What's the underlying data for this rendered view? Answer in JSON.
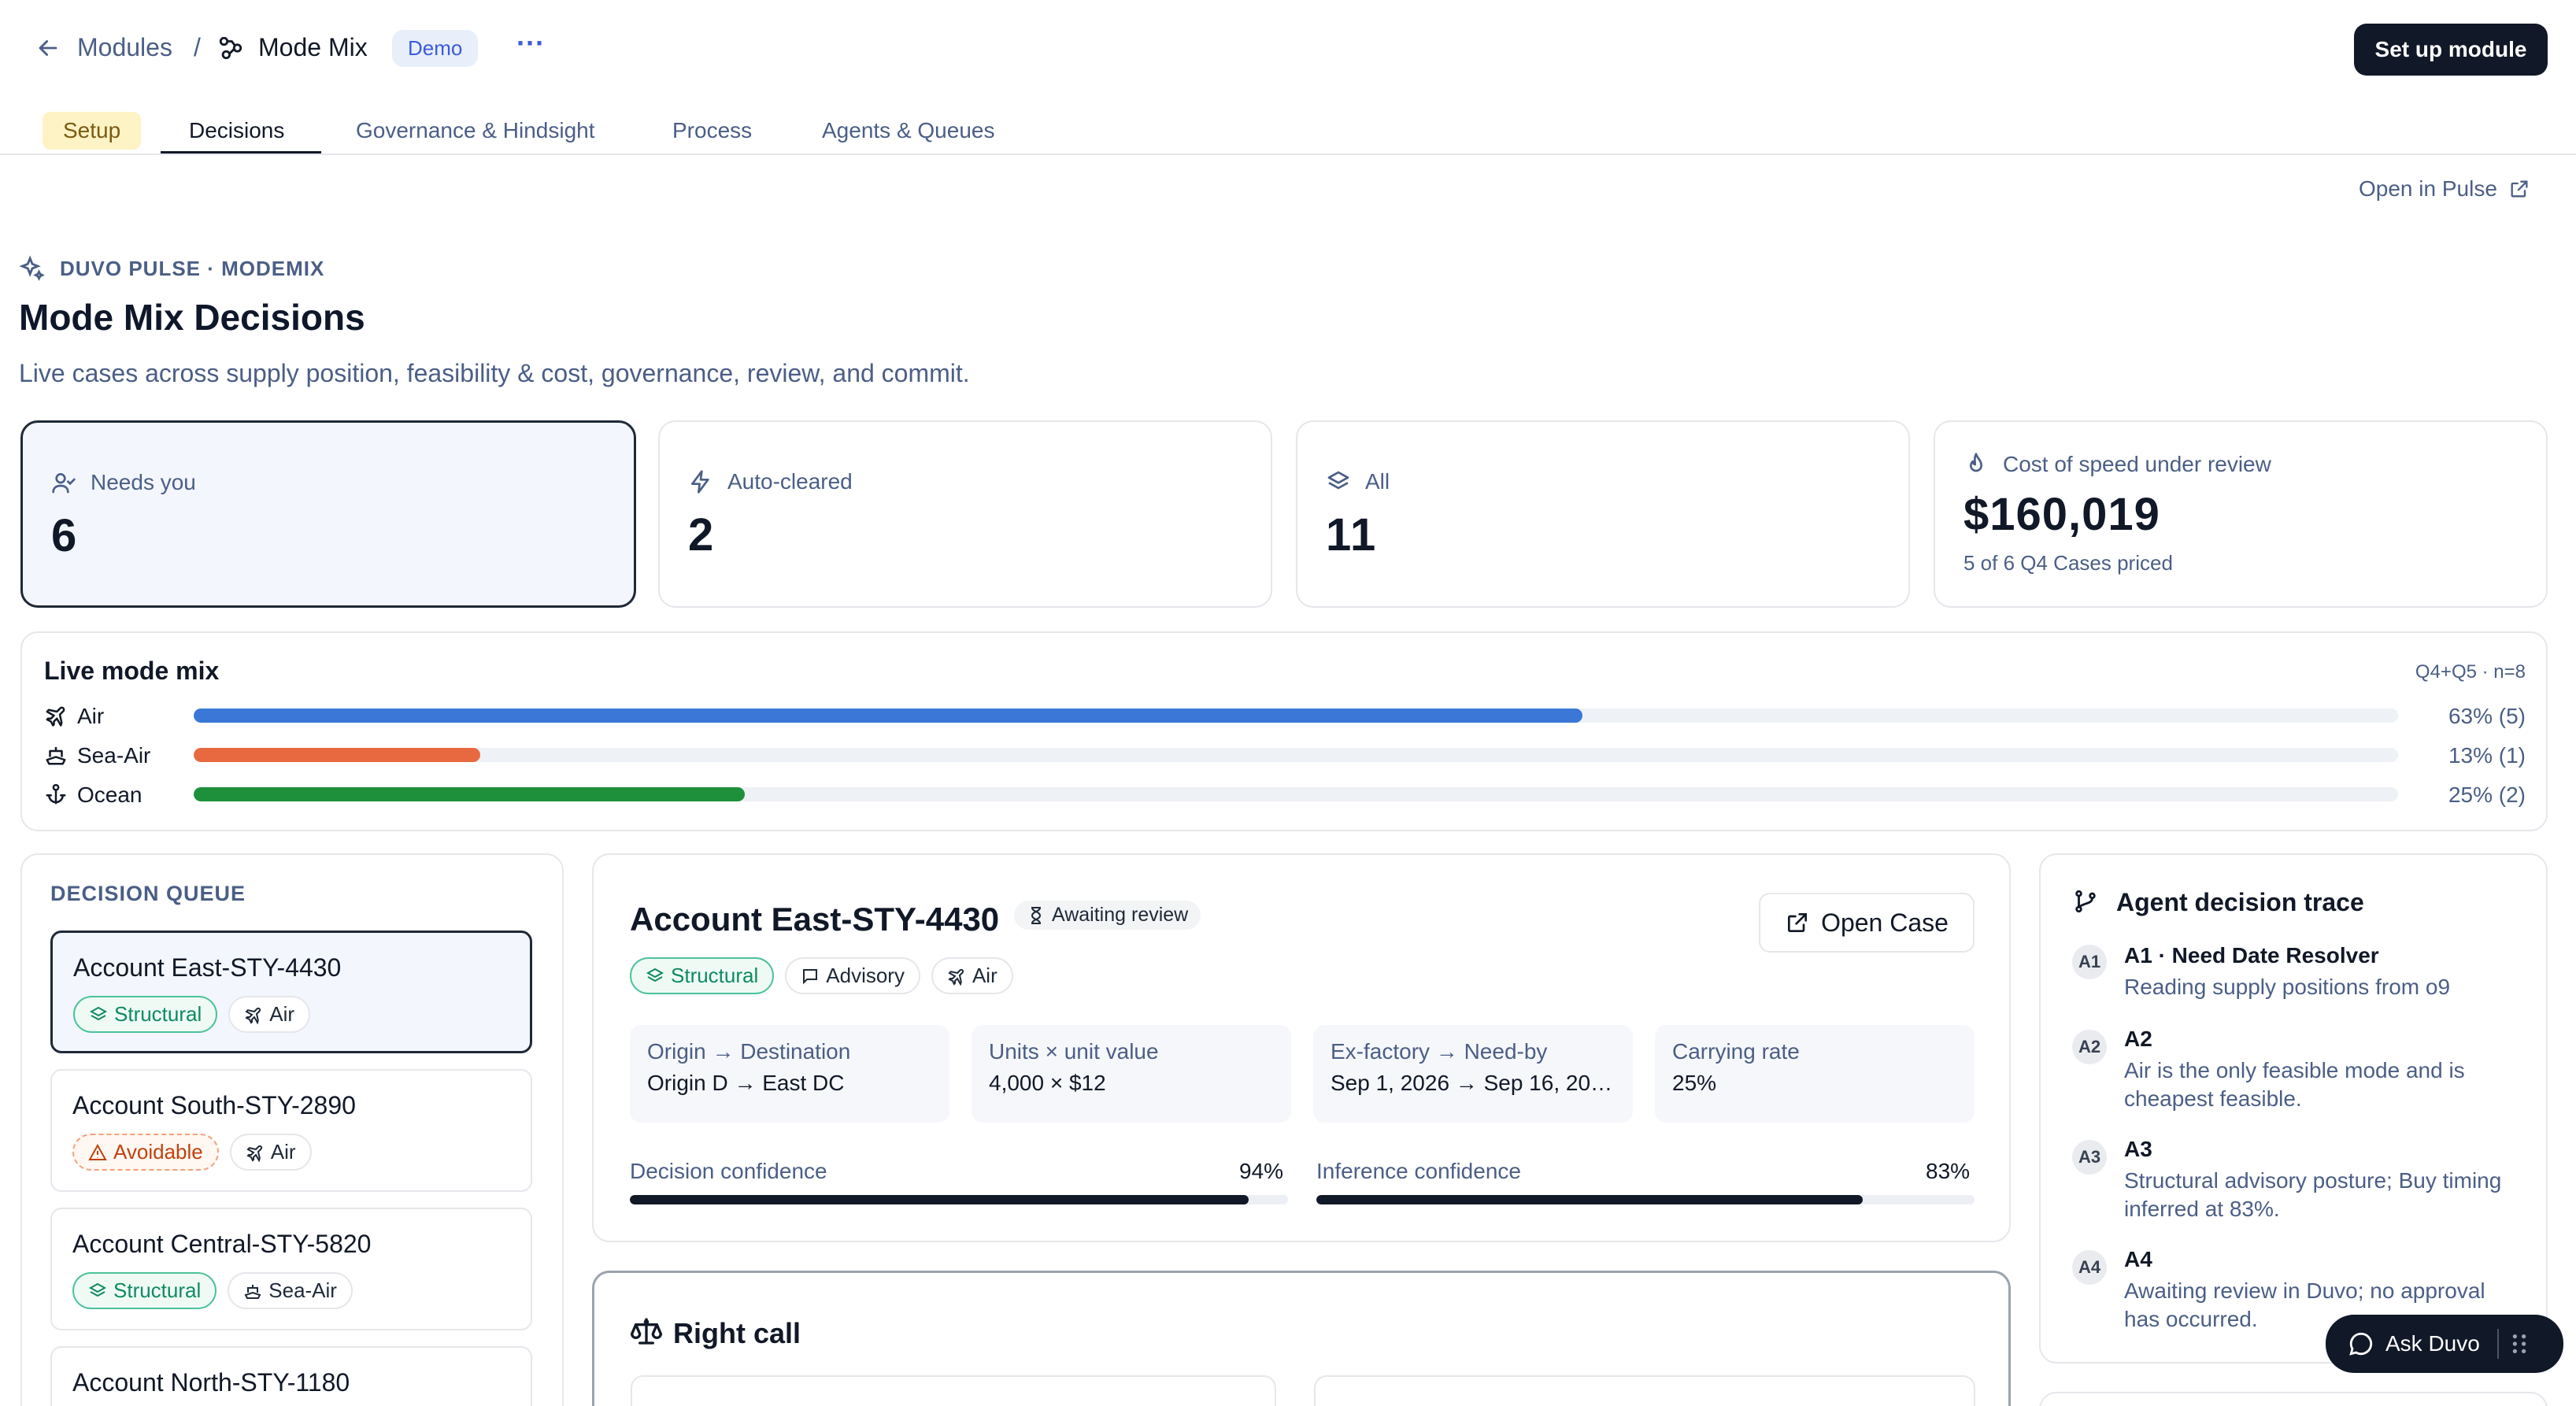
{
  "topbar": {
    "breadcrumb_parent": "Modules",
    "separator": "/",
    "module_name": "Mode Mix",
    "badge": "Demo",
    "more": "···",
    "setup_button": "Set up module"
  },
  "tabs": [
    {
      "label": "Setup"
    },
    {
      "label": "Decisions"
    },
    {
      "label": "Governance & Hindsight"
    },
    {
      "label": "Process"
    },
    {
      "label": "Agents & Queues"
    }
  ],
  "open_pulse": "Open in Pulse",
  "header": {
    "eyebrow": "DUVO PULSE · MODEMIX",
    "title": "Mode Mix Decisions",
    "subtitle": "Live cases across supply position, feasibility & cost, governance, review, and commit."
  },
  "stats": [
    {
      "label": "Needs you",
      "value": "6"
    },
    {
      "label": "Auto-cleared",
      "value": "2"
    },
    {
      "label": "All",
      "value": "11"
    },
    {
      "label": "Cost of speed under review",
      "value": "$160,019",
      "sub": "5 of 6 Q4 Cases priced"
    }
  ],
  "mode_mix": {
    "title": "Live mode mix",
    "meta": "Q4+Q5 · n=8",
    "rows": [
      {
        "label": "Air",
        "fraction": 0.63,
        "pct": "63% (5)",
        "color": "#3a77d6"
      },
      {
        "label": "Sea-Air",
        "fraction": 0.13,
        "pct": "13% (1)",
        "color": "#e8693f"
      },
      {
        "label": "Ocean",
        "fraction": 0.25,
        "pct": "25% (2)",
        "color": "#1e8f3a"
      }
    ]
  },
  "queue": {
    "title": "DECISION QUEUE",
    "items": [
      {
        "title": "Account East-STY-4430",
        "tag": "Structural",
        "mode": "Air"
      },
      {
        "title": "Account South-STY-2890",
        "tag": "Avoidable",
        "mode": "Air"
      },
      {
        "title": "Account Central-STY-5820",
        "tag": "Structural",
        "mode": "Sea-Air"
      },
      {
        "title": "Account North-STY-1180"
      }
    ]
  },
  "detail": {
    "title": "Account East-STY-4430",
    "status": "Awaiting review",
    "open_case": "Open Case",
    "chips": [
      "Structural",
      "Advisory",
      "Air"
    ],
    "fields": [
      {
        "label": "Origin → Destination",
        "value": "Origin D → East DC"
      },
      {
        "label": "Units × unit value",
        "value": "4,000 × $12"
      },
      {
        "label": "Ex-factory → Need-by",
        "value": "Sep 1, 2026 → Sep 16, 20…"
      },
      {
        "label": "Carrying rate",
        "value": "25%"
      }
    ],
    "decision_confidence": {
      "label": "Decision confidence",
      "value": "94%",
      "fraction": 0.94
    },
    "inference_confidence": {
      "label": "Inference confidence",
      "value": "83%",
      "fraction": 0.83
    }
  },
  "right_call": {
    "title": "Right call"
  },
  "trace": {
    "title": "Agent decision trace",
    "items": [
      {
        "badge": "A1",
        "head": "A1 · Need Date Resolver",
        "text": "Reading supply positions from o9"
      },
      {
        "badge": "A2",
        "head": "A2",
        "text": "Air is the only feasible mode and is cheapest feasible."
      },
      {
        "badge": "A3",
        "head": "A3",
        "text": "Structural advisory posture; Buy timing inferred at 83%."
      },
      {
        "badge": "A4",
        "head": "A4",
        "text": "Awaiting review in Duvo; no approval has occurred."
      }
    ]
  },
  "ask_duvo": "Ask Duvo",
  "icons": [
    "arrow-left-icon",
    "module-icon",
    "more-icon",
    "external-link-icon",
    "sparkle-icon",
    "user-check-icon",
    "bolt-icon",
    "layers-icon",
    "flame-icon",
    "plane-icon",
    "ship-icon",
    "anchor-icon",
    "hourglass-icon",
    "message-icon",
    "alert-icon",
    "branch-icon",
    "scale-icon",
    "chat-icon",
    "grip-icon"
  ]
}
